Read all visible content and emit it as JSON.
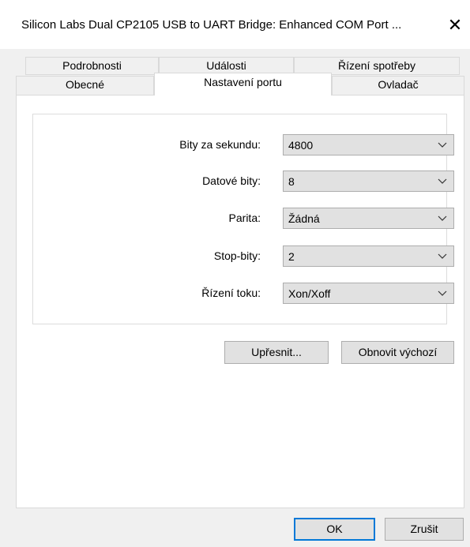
{
  "window": {
    "title": "Silicon Labs Dual CP2105 USB to UART Bridge: Enhanced COM Port ...",
    "close_icon": "close-icon",
    "close_glyph": "✕"
  },
  "tabs": {
    "row_back": [
      "Podrobnosti",
      "Události",
      "Řízení spotřeby"
    ],
    "row_front": [
      "Obecné",
      "Nastavení portu",
      "Ovladač"
    ],
    "active": "Nastavení portu"
  },
  "port_settings": {
    "rows": [
      {
        "label": "Bity za sekundu:",
        "value": "4800"
      },
      {
        "label": "Datové bity:",
        "value": "8"
      },
      {
        "label": "Parita:",
        "value": "Žádná"
      },
      {
        "label": "Stop-bity:",
        "value": "2"
      },
      {
        "label": "Řízení toku:",
        "value": "Xon/Xoff"
      }
    ],
    "advanced_button": "Upřesnit...",
    "restore_defaults_button": "Obnovit výchozí"
  },
  "footer": {
    "ok_button": "OK",
    "cancel_button": "Zrušit"
  }
}
